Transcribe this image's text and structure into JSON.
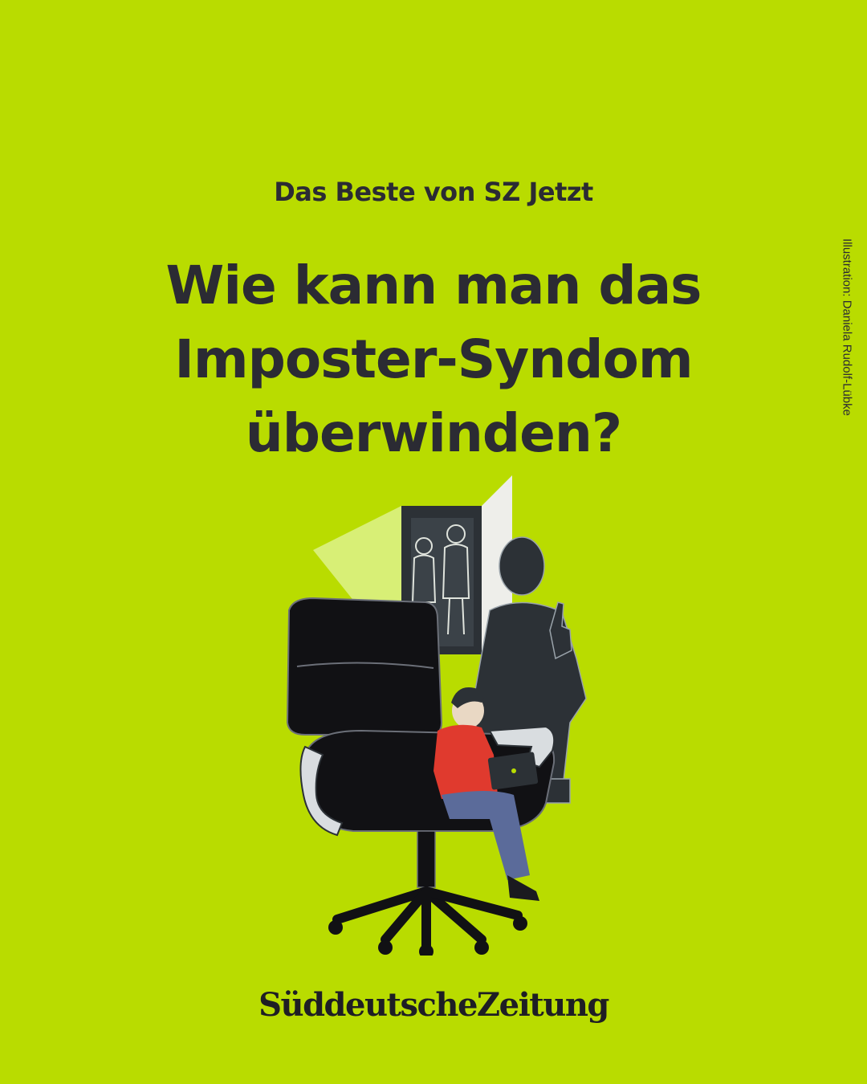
{
  "kicker": "Das Beste von SZ Jetzt",
  "headline": {
    "line1": "Wie kann man das",
    "line2": "Imposter-Syndom",
    "line3": "überwinden?"
  },
  "credit": "Illustration: Daniela Rudolf-Lübke",
  "logo": "SüddeutscheZeitung",
  "colors": {
    "background": "#b9dc00",
    "text": "#2b2b33",
    "sweater": "#e03a2e",
    "jeans": "#5b6b9a",
    "chair": "#111114"
  }
}
